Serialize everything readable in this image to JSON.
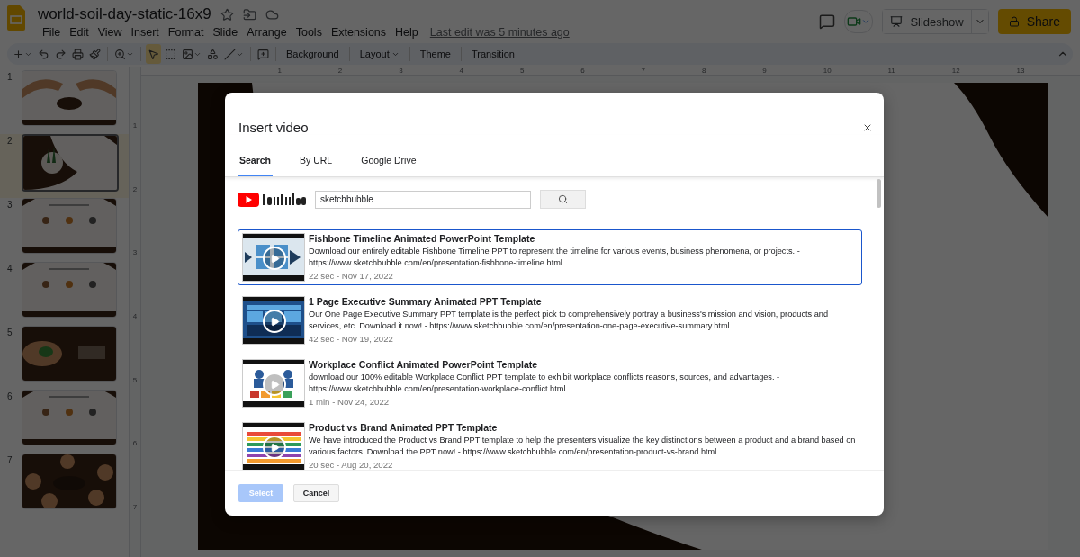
{
  "document": {
    "title": "world-soil-day-static-16x9",
    "last_edit": "Last edit was 5 minutes ago"
  },
  "menu": [
    "File",
    "Edit",
    "View",
    "Insert",
    "Format",
    "Slide",
    "Arrange",
    "Tools",
    "Extensions",
    "Help"
  ],
  "header_buttons": {
    "slideshow": "Slideshow",
    "share": "Share"
  },
  "toolbar": {
    "tools": [
      {
        "selected": false
      },
      {
        "selected": false
      },
      {
        "selected": false
      },
      {
        "selected": false
      },
      {
        "selected": false
      },
      {
        "selected": false
      },
      {
        "selected": true
      },
      {
        "selected": false
      },
      {
        "selected": false
      },
      {
        "selected": false
      },
      {
        "selected": false
      },
      {
        "selected": false
      }
    ],
    "text_buttons": [
      {
        "label": "Background",
        "has_menu": false
      },
      {
        "label": "Layout",
        "has_menu": true
      },
      {
        "label": "Theme",
        "has_menu": false
      },
      {
        "label": "Transition",
        "has_menu": false
      }
    ]
  },
  "slides": [
    {
      "number": "1",
      "selected": false
    },
    {
      "number": "2",
      "selected": true
    },
    {
      "number": "3",
      "selected": false
    },
    {
      "number": "4",
      "selected": false
    },
    {
      "number": "5",
      "selected": false
    },
    {
      "number": "6",
      "selected": false
    },
    {
      "number": "7",
      "selected": false
    }
  ],
  "rulers": {
    "horizontal": [
      "1",
      "2",
      "3",
      "4",
      "5",
      "6",
      "7",
      "8",
      "9",
      "10",
      "11",
      "12",
      "13"
    ],
    "vertical": [
      "1",
      "2",
      "3",
      "4",
      "5",
      "6",
      "7"
    ]
  },
  "dialog": {
    "title": "Insert video",
    "tabs": [
      {
        "label": "Search",
        "selected": true
      },
      {
        "label": "By URL",
        "selected": false
      },
      {
        "label": "Google Drive",
        "selected": false
      }
    ],
    "search": {
      "value": "sketchbubble"
    },
    "results": [
      {
        "title": "Fishbone Timeline Animated PowerPoint Template",
        "description": "Download our entirely editable Fishbone Timeline PPT to represent the timeline for various events, business phenomena, or projects. - https://www.sketchbubble.com/en/presentation-fishbone-timeline.html",
        "meta": "22 sec - Nov 17, 2022",
        "selected": true
      },
      {
        "title": "1 Page Executive Summary Animated PPT Template",
        "description": "Our One Page Executive Summary PPT template is the perfect pick to comprehensively portray a business's mission and vision, products and services, etc. Download it now! - https://www.sketchbubble.com/en/presentation-one-page-executive-summary.html",
        "meta": "42 sec - Nov 19, 2022",
        "selected": false
      },
      {
        "title": "Workplace Conflict Animated PowerPoint Template",
        "description": "download our 100% editable Workplace Conflict PPT template to exhibit workplace conflicts reasons, sources, and advantages. - https://www.sketchbubble.com/en/presentation-workplace-conflict.html",
        "meta": "1 min - Nov 24, 2022",
        "selected": false
      },
      {
        "title": "Product vs Brand Animated PPT Template",
        "description": "We have introduced the Product vs Brand PPT template to help the presenters visualize the key distinctions between a product and a brand based on various factors. Download the PPT now! - https://www.sketchbubble.com/en/presentation-product-vs-brand.html",
        "meta": "20 sec - Aug 20, 2022",
        "selected": false
      }
    ],
    "buttons": {
      "select": {
        "label": "Select",
        "disabled": true
      },
      "cancel": {
        "label": "Cancel"
      }
    }
  }
}
